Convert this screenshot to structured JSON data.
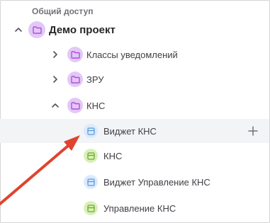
{
  "section": {
    "title": "Общий доступ"
  },
  "tree": {
    "root": {
      "label": "Демо проект",
      "icon": "folder-icon",
      "expanded": true
    },
    "children": [
      {
        "label": "Классы уведомлений",
        "icon": "folder-icon",
        "expanded": false
      },
      {
        "label": "ЗРУ",
        "icon": "folder-icon",
        "expanded": false
      },
      {
        "label": "КНС",
        "icon": "folder-icon",
        "expanded": true
      },
      {
        "label": "Виджет КНС",
        "icon": "widget-icon",
        "selected": true
      },
      {
        "label": "КНС",
        "icon": "dashboard-icon"
      },
      {
        "label": "Виджет Управление КНС",
        "icon": "widget-icon"
      },
      {
        "label": "Управление КНС",
        "icon": "dashboard-icon"
      }
    ]
  },
  "actions": {
    "add_icon": "plus-icon"
  },
  "colors": {
    "folder_badge": "#e3c8f7",
    "folder_icon": "#b04fd6",
    "widget_badge": "#dbeafe",
    "widget_icon": "#5b9bd5",
    "dashboard_badge": "#d9f0b8",
    "dashboard_icon": "#6aaa2a",
    "selected_row": "#f3f4f6",
    "annotation_arrow": "#e0432f"
  }
}
